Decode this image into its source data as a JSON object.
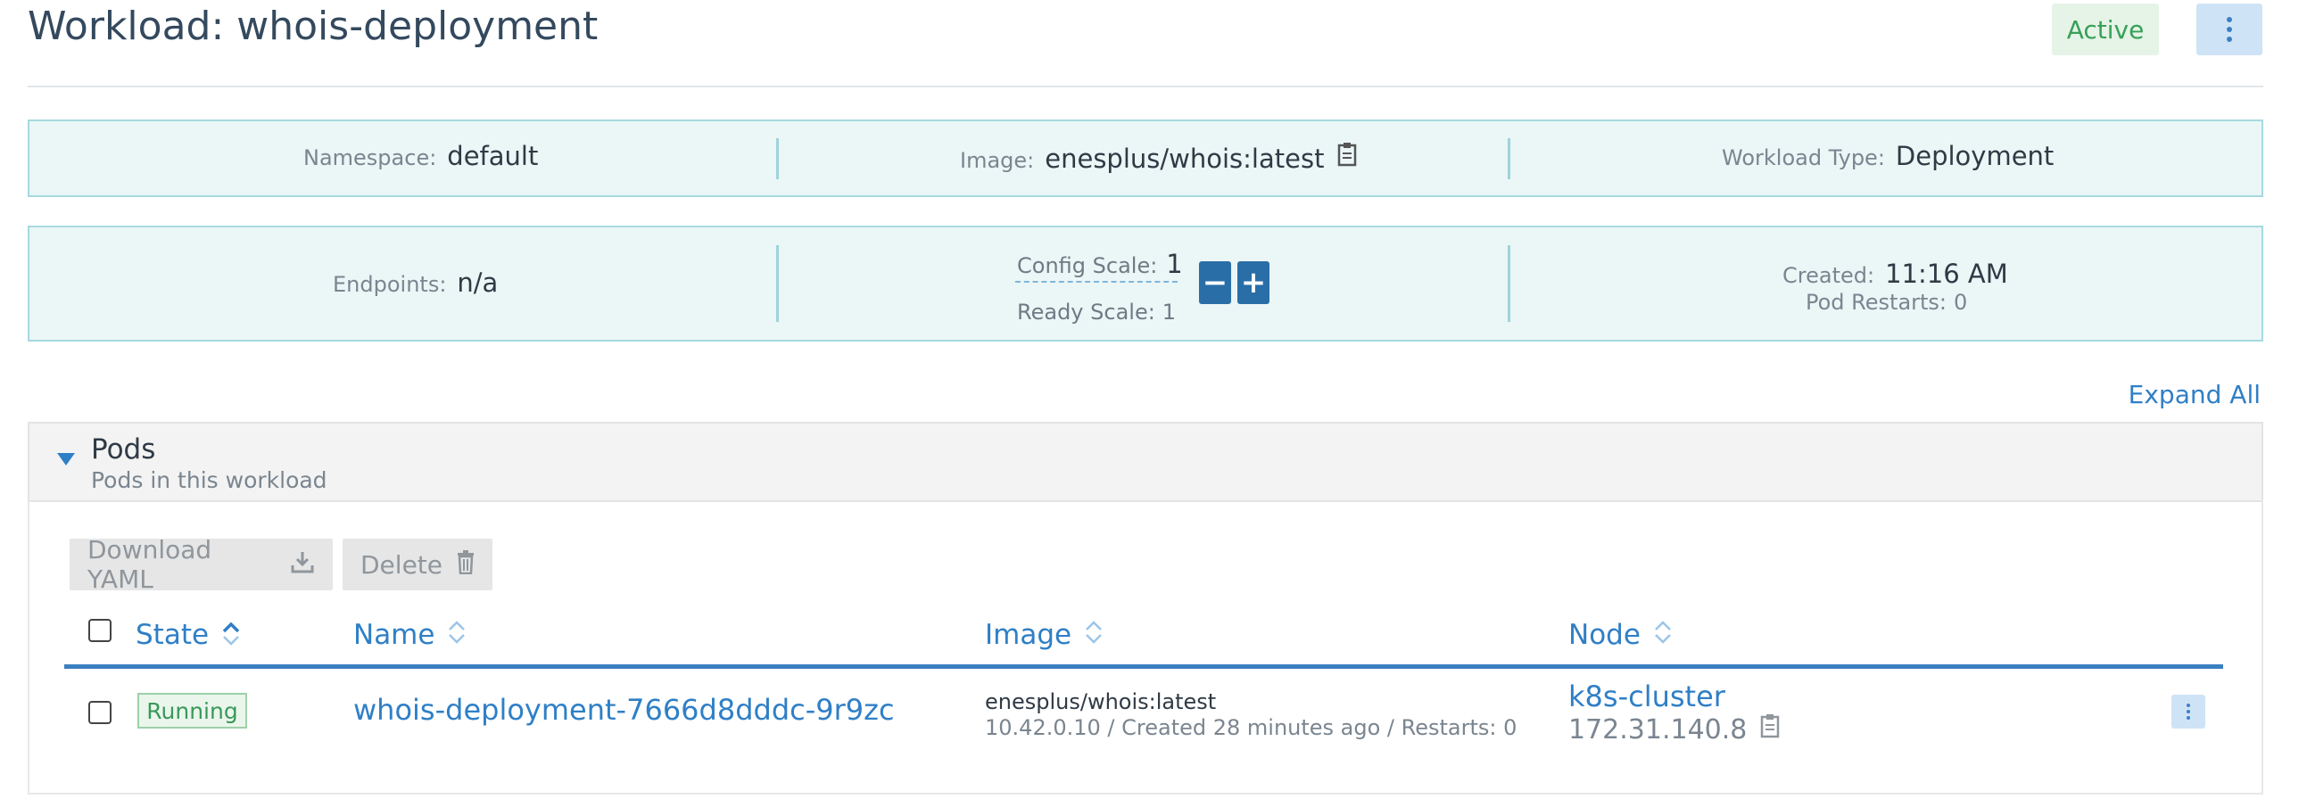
{
  "header": {
    "title": "Workload: whois-deployment",
    "status": "Active"
  },
  "info": {
    "namespace_label": "Namespace:",
    "namespace_value": "default",
    "image_label": "Image:",
    "image_value": "enesplus/whois:latest",
    "workload_type_label": "Workload Type:",
    "workload_type_value": "Deployment",
    "endpoints_label": "Endpoints:",
    "endpoints_value": "n/a",
    "config_scale_label": "Config Scale:",
    "config_scale_value": "1",
    "ready_scale_label": "Ready Scale:",
    "ready_scale_value": "1",
    "scale_down_label": "−",
    "scale_up_label": "+",
    "created_label": "Created:",
    "created_value": "11:16 AM",
    "pod_restarts_label": "Pod Restarts:",
    "pod_restarts_value": "0"
  },
  "expand_all": "Expand All",
  "pods": {
    "title": "Pods",
    "subtitle": "Pods in this workload",
    "toolbar": {
      "download_yaml": "Download YAML",
      "delete": "Delete"
    },
    "columns": {
      "state": "State",
      "name": "Name",
      "image": "Image",
      "node": "Node"
    },
    "rows": [
      {
        "state": "Running",
        "name": "whois-deployment-7666d8dddc-9r9zc",
        "image": "enesplus/whois:latest",
        "meta": "10.42.0.10 / Created 28 minutes ago / Restarts: 0",
        "node": "k8s-cluster",
        "node_ip": "172.31.140.8"
      }
    ]
  },
  "colors": {
    "accent": "#2f7fc6",
    "status_green": "#38a058",
    "info_bg": "#ebf6f7"
  },
  "icons": [
    "kebab-menu-icon",
    "copy-icon",
    "caret-down-icon",
    "download-icon",
    "trash-icon",
    "sort-icon"
  ]
}
